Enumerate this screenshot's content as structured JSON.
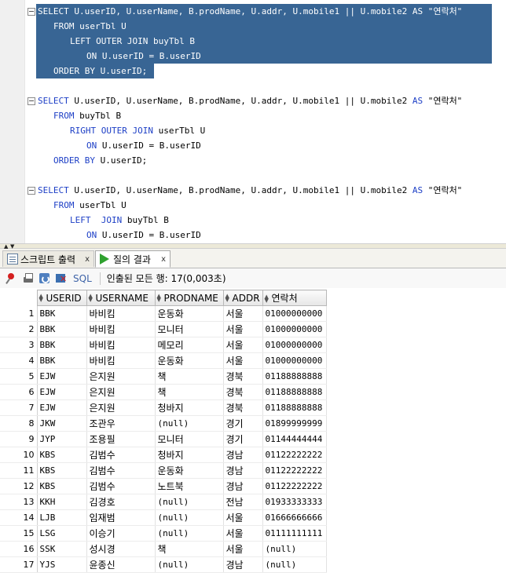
{
  "editor": {
    "blocks": [
      {
        "lines": [
          [
            [
              "SELECT ",
              "kw"
            ],
            [
              "U.userID, U.userName, B.prodName, U.addr, U.mobile1 || U.mobile2 ",
              ""
            ],
            [
              "AS ",
              "kw"
            ],
            [
              "\"연락처\"",
              ""
            ]
          ],
          [
            [
              "FROM ",
              "kw"
            ],
            [
              "userTbl U",
              ""
            ]
          ],
          [
            [
              "LEFT OUTER JOIN ",
              "kw"
            ],
            [
              "buyTbl B",
              ""
            ]
          ],
          [
            [
              "ON ",
              "kw"
            ],
            [
              "U.userID = B.userID",
              ""
            ]
          ],
          [
            [
              "ORDER BY ",
              "kw"
            ],
            [
              "U.userID;",
              ""
            ]
          ]
        ]
      },
      {
        "lines": [
          [
            [
              "SELECT ",
              "kw"
            ],
            [
              "U.userID, U.userName, B.prodName, U.addr, U.mobile1 || U.mobile2 ",
              ""
            ],
            [
              "AS ",
              "kw"
            ],
            [
              "\"연락처\"",
              ""
            ]
          ],
          [
            [
              "FROM ",
              "kw"
            ],
            [
              "buyTbl B",
              ""
            ]
          ],
          [
            [
              "RIGHT OUTER JOIN ",
              "kw"
            ],
            [
              "userTbl U",
              ""
            ]
          ],
          [
            [
              "ON ",
              "kw"
            ],
            [
              "U.userID = B.userID",
              ""
            ]
          ],
          [
            [
              "ORDER BY ",
              "kw"
            ],
            [
              "U.userID;",
              ""
            ]
          ]
        ]
      },
      {
        "lines": [
          [
            [
              "SELECT ",
              "kw"
            ],
            [
              "U.userID, U.userName, B.prodName, U.addr, U.mobile1 || U.mobile2 ",
              ""
            ],
            [
              "AS ",
              "kw"
            ],
            [
              "\"연락처\"",
              ""
            ]
          ],
          [
            [
              "FROM ",
              "kw"
            ],
            [
              "userTbl U",
              ""
            ]
          ],
          [
            [
              "LEFT  JOIN ",
              "kw"
            ],
            [
              "buyTbl B",
              ""
            ]
          ],
          [
            [
              "ON ",
              "kw"
            ],
            [
              "U.userID = B.userID",
              ""
            ]
          ]
        ]
      }
    ],
    "keyword_color": "#1d3fc6",
    "selection_color": "#386594"
  },
  "tabs": [
    {
      "label": "스크립트 출력",
      "close": "x",
      "active": false
    },
    {
      "label": "질의 결과",
      "close": "x",
      "active": true
    }
  ],
  "toolbar": {
    "sql_label": "SQL",
    "status": "인출된 모든 행: 17(0,003초)"
  },
  "grid": {
    "columns": [
      "USERID",
      "USERNAME",
      "PRODNAME",
      "ADDR",
      "연락처"
    ],
    "rows": [
      [
        "1",
        "BBK",
        "바비킴",
        "운동화",
        "서울",
        "01000000000"
      ],
      [
        "2",
        "BBK",
        "바비킴",
        "모니터",
        "서울",
        "01000000000"
      ],
      [
        "3",
        "BBK",
        "바비킴",
        "메모리",
        "서울",
        "01000000000"
      ],
      [
        "4",
        "BBK",
        "바비킴",
        "운동화",
        "서울",
        "01000000000"
      ],
      [
        "5",
        "EJW",
        "은지원",
        "책",
        "경북",
        "01188888888"
      ],
      [
        "6",
        "EJW",
        "은지원",
        "책",
        "경북",
        "01188888888"
      ],
      [
        "7",
        "EJW",
        "은지원",
        "청바지",
        "경북",
        "01188888888"
      ],
      [
        "8",
        "JKW",
        "조관우",
        "(null)",
        "경기",
        "01899999999"
      ],
      [
        "9",
        "JYP",
        "조용필",
        "모니터",
        "경기",
        "01144444444"
      ],
      [
        "10",
        "KBS",
        "김범수",
        "청바지",
        "경남",
        "01122222222"
      ],
      [
        "11",
        "KBS",
        "김범수",
        "운동화",
        "경남",
        "01122222222"
      ],
      [
        "12",
        "KBS",
        "김범수",
        "노트북",
        "경남",
        "01122222222"
      ],
      [
        "13",
        "KKH",
        "김경호",
        "(null)",
        "전남",
        "01933333333"
      ],
      [
        "14",
        "LJB",
        "임재범",
        "(null)",
        "서울",
        "01666666666"
      ],
      [
        "15",
        "LSG",
        "이승기",
        "(null)",
        "서울",
        "01111111111"
      ],
      [
        "16",
        "SSK",
        "성시경",
        "책",
        "서울",
        "(null)"
      ],
      [
        "17",
        "YJS",
        "윤종신",
        "(null)",
        "경남",
        "(null)"
      ]
    ]
  }
}
